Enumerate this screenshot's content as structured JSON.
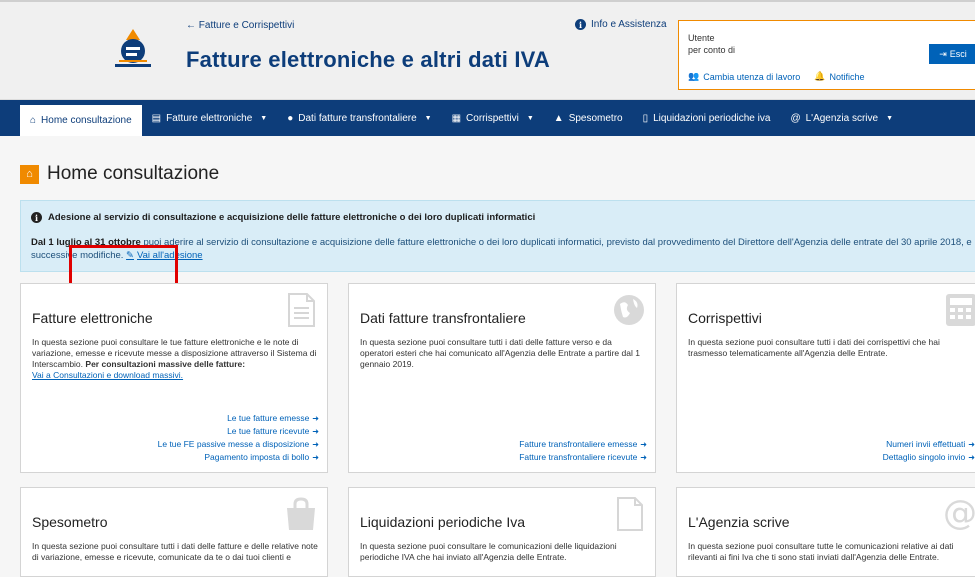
{
  "header": {
    "back_link": "← Fatture e Corrispettivi",
    "title": "Fatture elettroniche e altri dati IVA",
    "info_link": "Info e Assistenza",
    "user_label": "Utente",
    "on_behalf_label": "per conto di",
    "logout_label": "Esci",
    "change_utility_label": "Cambia utenza di lavoro",
    "notifications_label": "Notifiche",
    "colors": {
      "brand_blue": "#0d3d7a",
      "accent_orange": "#f08a00"
    }
  },
  "nav": {
    "items": [
      {
        "label": "Home consultazione",
        "icon": "home-icon",
        "dropdown": false,
        "active": true
      },
      {
        "label": "Fatture elettroniche",
        "icon": "document-icon",
        "dropdown": true,
        "active": false
      },
      {
        "label": "Dati fatture transfrontaliere",
        "icon": "globe-icon",
        "dropdown": true,
        "active": false
      },
      {
        "label": "Corrispettivi",
        "icon": "calculator-icon",
        "dropdown": true,
        "active": false
      },
      {
        "label": "Spesometro",
        "icon": "bag-icon",
        "dropdown": false,
        "active": false
      },
      {
        "label": "Liquidazioni periodiche iva",
        "icon": "file-icon",
        "dropdown": false,
        "active": false
      },
      {
        "label": "L'Agenzia scrive",
        "icon": "at-icon",
        "dropdown": true,
        "active": false
      }
    ]
  },
  "page": {
    "title": "Home consultazione"
  },
  "alert": {
    "title": "Adesione al servizio di consultazione e acquisizione delle fatture elettroniche o dei loro duplicati informatici",
    "body_bold": "Dal 1 luglio al 31 ottobre",
    "body_text": " puoi aderire al servizio di consultazione e acquisizione delle fatture elettroniche o dei loro duplicati informatici, previsto dal provvedimento del Direttore dell'Agenzia delle entrate del 30 aprile 2018, e successive modifiche.",
    "link_label": "Vai all'adesione"
  },
  "cards": {
    "fatture": {
      "title": "Fatture elettroniche",
      "text_1": "In questa sezione puoi consultare le tue fatture elettroniche e le note di variazione, emesse e ricevute messe a disposizione attraverso il Sistema di Interscambio.",
      "text_bold": "Per consultazioni massive delle fatture:",
      "text_link": "Vai a Consultazioni e download massivi.",
      "links": [
        "Le tue fatture emesse",
        "Le tue fatture ricevute",
        "Le tue FE passive messe a disposizione",
        "Pagamento imposta di bollo"
      ]
    },
    "transfrontaliere": {
      "title": "Dati fatture transfrontaliere",
      "text": "In questa sezione puoi consultare tutti i dati delle fatture verso e da operatori esteri che hai comunicato all'Agenzia delle Entrate a partire dal 1 gennaio 2019.",
      "links": [
        "Fatture transfrontaliere emesse",
        "Fatture transfrontaliere ricevute"
      ]
    },
    "corrispettivi": {
      "title": "Corrispettivi",
      "text": "In questa sezione puoi consultare tutti i dati dei corrispettivi che hai trasmesso telematicamente all'Agenzia delle Entrate.",
      "links": [
        "Numeri invii effettuati",
        "Dettaglio singolo invio"
      ]
    },
    "spesometro": {
      "title": "Spesometro",
      "text": "In questa sezione puoi consultare tutti i dati delle fatture e delle relative note di variazione, emesse e ricevute, comunicate da te o dai tuoi clienti e"
    },
    "liquidazioni": {
      "title": "Liquidazioni periodiche Iva",
      "text": "In questa sezione puoi consultare le comunicazioni delle liquidazioni periodiche IVA che hai inviato all'Agenzia delle Entrate."
    },
    "agenzia": {
      "title": "L'Agenzia scrive",
      "text": "In questa sezione puoi consultare tutte le comunicazioni relative ai dati rilevanti ai fini Iva che ti sono stati inviati dall'Agenzia delle Entrate."
    }
  }
}
